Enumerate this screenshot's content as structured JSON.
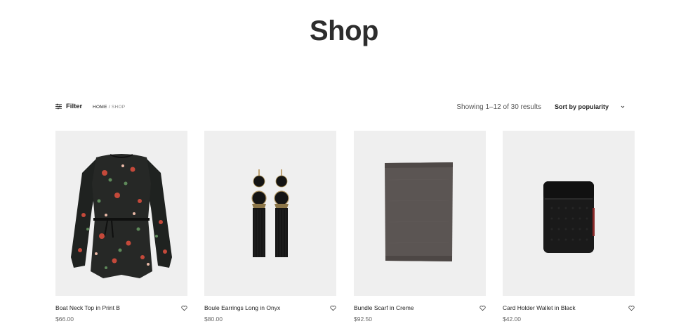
{
  "page": {
    "title": "Shop"
  },
  "toolbar": {
    "filter_label": "Filter",
    "breadcrumb": {
      "home": "HOME",
      "separator": "/",
      "current": "SHOP"
    },
    "result_count": "Showing 1–12 of 30 results",
    "sort_label": "Sort by popularity"
  },
  "products": [
    {
      "name": "Boat Neck Top in Print B",
      "price": "$66.00",
      "image": "floral-sheer-blouse"
    },
    {
      "name": "Boule Earrings Long in Onyx",
      "price": "$80.00",
      "image": "tassel-earrings"
    },
    {
      "name": "Bundle Scarf in Creme",
      "price": "$92.50",
      "image": "folded-grey-scarf"
    },
    {
      "name": "Card Holder Wallet in Black",
      "price": "$42.00",
      "image": "black-card-wallet"
    }
  ],
  "colors": {
    "thumb_bg": "#efefef",
    "text": "#222222",
    "muted": "#666666"
  }
}
